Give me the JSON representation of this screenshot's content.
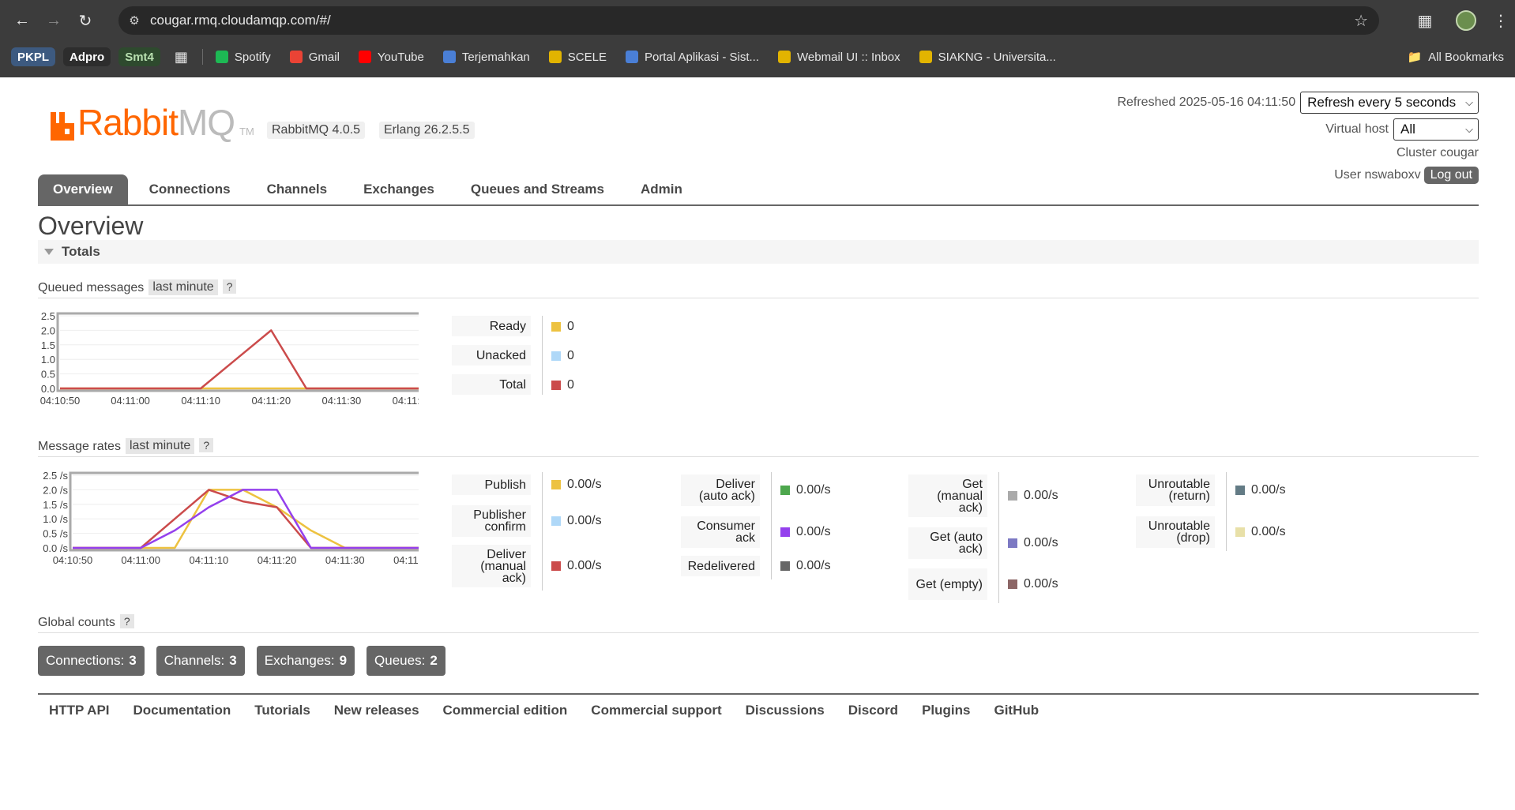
{
  "browser": {
    "url": "cougar.rmq.cloudamqp.com/#/",
    "bookmarks": [
      {
        "label": "PKPL",
        "kind": "chip",
        "bg": "#3d5a80",
        "fg": "#ffffff"
      },
      {
        "label": "Adpro",
        "kind": "chip",
        "bg": "#2d2d2d",
        "fg": "#ffffff"
      },
      {
        "label": "Smt4",
        "kind": "chip",
        "bg": "#2e4a2e",
        "fg": "#b8e0b0"
      }
    ],
    "bookmark_links": [
      {
        "label": "Spotify",
        "color": "#1db954"
      },
      {
        "label": "Gmail",
        "color": "#ea4335"
      },
      {
        "label": "YouTube",
        "color": "#ff0000"
      },
      {
        "label": "Terjemahkan",
        "color": "#4a7fd6"
      },
      {
        "label": "SCELE",
        "color": "#e2b400"
      },
      {
        "label": "Portal Aplikasi - Sist...",
        "color": "#4a7fd6"
      },
      {
        "label": "Webmail UI :: Inbox",
        "color": "#e2b400"
      },
      {
        "label": "SIAKNG - Universita...",
        "color": "#e2b400"
      }
    ],
    "all_bookmarks": "All Bookmarks"
  },
  "header": {
    "logo_rabbit": "Rabbit",
    "logo_mq": "MQ",
    "logo_tm": "TM",
    "rabbitmq_version": "RabbitMQ 4.0.5",
    "erlang_version": "Erlang 26.2.5.5",
    "refreshed_label": "Refreshed 2025-05-16 04:11:50",
    "refresh_select": "Refresh every 5 seconds",
    "vhost_label": "Virtual host",
    "vhost_select": "All",
    "cluster": "Cluster cougar",
    "user": "User nswaboxv",
    "logout": "Log out"
  },
  "tabs": [
    "Overview",
    "Connections",
    "Channels",
    "Exchanges",
    "Queues and Streams",
    "Admin"
  ],
  "page_title": "Overview",
  "section": "Totals",
  "queued": {
    "label": "Queued messages",
    "range": "last minute",
    "help": "?",
    "stats": [
      {
        "label": "Ready",
        "value": "0",
        "color": "#edc240"
      },
      {
        "label": "Unacked",
        "value": "0",
        "color": "#afd8f8"
      },
      {
        "label": "Total",
        "value": "0",
        "color": "#cb4b4b"
      }
    ]
  },
  "rates": {
    "label": "Message rates",
    "range": "last minute",
    "help": "?",
    "col1": [
      {
        "label": "Publish",
        "value": "0.00/s",
        "color": "#edc240"
      },
      {
        "label": "Publisher confirm",
        "value": "0.00/s",
        "color": "#afd8f8"
      },
      {
        "label": "Deliver (manual ack)",
        "value": "0.00/s",
        "color": "#cb4b4b"
      }
    ],
    "col2": [
      {
        "label": "Deliver (auto ack)",
        "value": "0.00/s",
        "color": "#4da74d"
      },
      {
        "label": "Consumer ack",
        "value": "0.00/s",
        "color": "#9440ed"
      },
      {
        "label": "Redelivered",
        "value": "0.00/s",
        "color": "#666666"
      }
    ],
    "col3": [
      {
        "label": "Get (manual ack)",
        "value": "0.00/s",
        "color": "#aaaaaa"
      },
      {
        "label": "Get (auto ack)",
        "value": "0.00/s",
        "color": "#7c79c3"
      },
      {
        "label": "Get (empty)",
        "value": "0.00/s",
        "color": "#8c6666"
      }
    ],
    "col4": [
      {
        "label": "Unroutable (return)",
        "value": "0.00/s",
        "color": "#637b85"
      },
      {
        "label": "Unroutable (drop)",
        "value": "0.00/s",
        "color": "#e8e0a8"
      }
    ]
  },
  "global": {
    "label": "Global counts",
    "help": "?",
    "counts": [
      {
        "label": "Connections:",
        "value": "3"
      },
      {
        "label": "Channels:",
        "value": "3"
      },
      {
        "label": "Exchanges:",
        "value": "9"
      },
      {
        "label": "Queues:",
        "value": "2"
      }
    ]
  },
  "footer": [
    "HTTP API",
    "Documentation",
    "Tutorials",
    "New releases",
    "Commercial edition",
    "Commercial support",
    "Discussions",
    "Discord",
    "Plugins",
    "GitHub"
  ],
  "chart_data": [
    {
      "type": "line",
      "title": "",
      "x": [
        "04:10:50",
        "04:10:55",
        "04:11:00",
        "04:11:05",
        "04:11:10",
        "04:11:15",
        "04:11:20",
        "04:11:25",
        "04:11:30",
        "04:11:35",
        "04:11:40",
        "04:11:45"
      ],
      "x_ticks": [
        "04:10:50",
        "04:11:00",
        "04:11:10",
        "04:11:20",
        "04:11:30",
        "04:11:40"
      ],
      "y_ticks": [
        "2.5",
        "2.0",
        "1.5",
        "1.0",
        "0.5",
        "0.0"
      ],
      "ylim": [
        0,
        2.5
      ],
      "series": [
        {
          "name": "Ready",
          "color": "#edc240",
          "values": [
            0,
            0,
            0,
            0,
            0,
            0,
            0,
            0,
            0,
            0,
            0,
            0
          ]
        },
        {
          "name": "Total",
          "color": "#cb4b4b",
          "values": [
            0,
            0,
            0,
            0,
            0,
            1,
            2,
            0,
            0,
            0,
            0,
            0
          ]
        }
      ]
    },
    {
      "type": "line",
      "title": "",
      "x": [
        "04:10:50",
        "04:10:55",
        "04:11:00",
        "04:11:05",
        "04:11:10",
        "04:11:15",
        "04:11:20",
        "04:11:25",
        "04:11:30",
        "04:11:35",
        "04:11:40",
        "04:11:45"
      ],
      "x_ticks": [
        "04:10:50",
        "04:11:00",
        "04:11:10",
        "04:11:20",
        "04:11:30",
        "04:11:40"
      ],
      "y_ticks": [
        "2.5 /s",
        "2.0 /s",
        "1.5 /s",
        "1.0 /s",
        "0.5 /s",
        "0.0 /s"
      ],
      "ylim": [
        0,
        2.5
      ],
      "series": [
        {
          "name": "Publish",
          "color": "#edc240",
          "values": [
            0,
            0,
            0,
            0,
            2,
            2,
            1.4,
            0.6,
            0,
            0,
            0,
            0
          ]
        },
        {
          "name": "Deliver (manual ack)",
          "color": "#cb4b4b",
          "values": [
            0,
            0,
            0,
            1,
            2,
            1.6,
            1.4,
            0,
            0,
            0,
            0,
            0
          ]
        },
        {
          "name": "Consumer ack",
          "color": "#9440ed",
          "values": [
            0,
            0,
            0,
            0.6,
            1.4,
            2,
            2,
            0,
            0,
            0,
            0,
            0
          ]
        }
      ]
    }
  ]
}
